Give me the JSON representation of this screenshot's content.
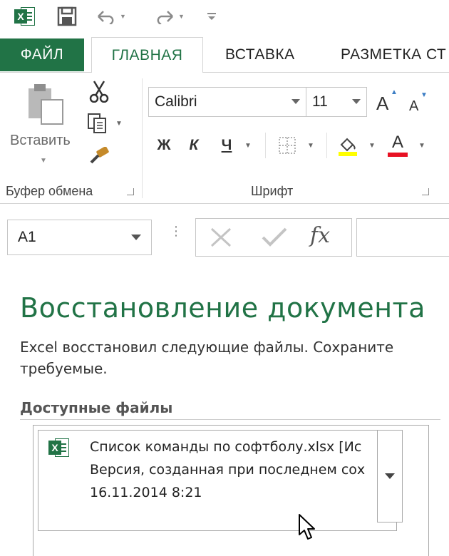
{
  "qat": {
    "app_icon": "excel-icon",
    "save_icon": "save-icon",
    "undo_icon": "undo-icon",
    "redo_icon": "redo-icon",
    "customize_icon": "customize-qat-icon"
  },
  "tabs": [
    {
      "label": "ФАЙЛ"
    },
    {
      "label": "ГЛАВНАЯ"
    },
    {
      "label": "ВСТАВКА"
    },
    {
      "label": "РАЗМЕТКА СТ"
    }
  ],
  "ribbon": {
    "clipboard": {
      "paste_label": "Вставить",
      "group_label": "Буфер обмена"
    },
    "font": {
      "font_name": "Calibri",
      "font_size": "11",
      "grow_label": "A",
      "shrink_label": "A",
      "bold_label": "Ж",
      "italic_label": "К",
      "underline_label": "Ч",
      "font_color_label": "A",
      "group_label": "Шрифт",
      "highlight_color": "#ffff00",
      "font_color": "#e81123"
    }
  },
  "formula_bar": {
    "name_box": "A1",
    "fx_label": "fx"
  },
  "recovery": {
    "title": "Восстановление документа",
    "description": "Excel восстановил следующие файлы.  Сохраните требуемые.",
    "section_title": "Доступные файлы",
    "files": [
      {
        "name": "Список команды по софтболу.xlsx  [Ис",
        "version": "Версия, созданная при последнем сох",
        "date": "16.11.2014 8:21"
      }
    ]
  },
  "colors": {
    "accent": "#217346"
  }
}
